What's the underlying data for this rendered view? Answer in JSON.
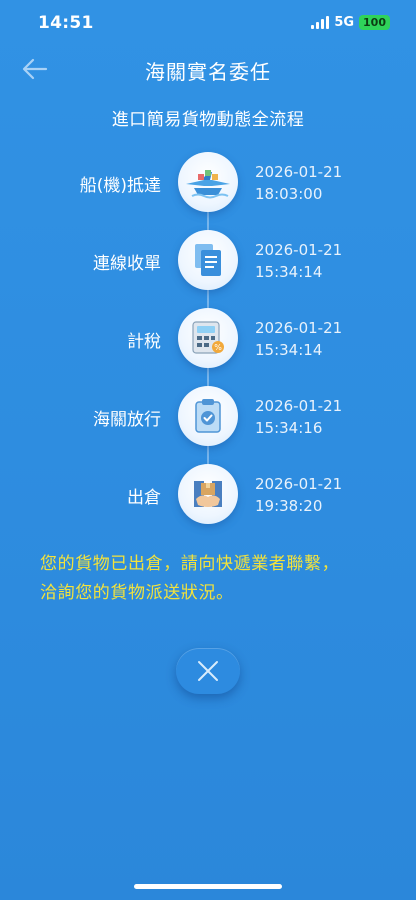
{
  "status_bar": {
    "time": "14:51",
    "network": "5G",
    "battery": "100"
  },
  "header": {
    "title": "海關實名委任",
    "back_icon": "arrow-left-icon"
  },
  "subtitle": "進口簡易貨物動態全流程",
  "steps": [
    {
      "label": "船(機)抵達",
      "date": "2026-01-21",
      "time": "18:03:00",
      "icon": "ship-plane-icon"
    },
    {
      "label": "連線收單",
      "date": "2026-01-21",
      "time": "15:34:14",
      "icon": "documents-icon"
    },
    {
      "label": "計稅",
      "date": "2026-01-21",
      "time": "15:34:14",
      "icon": "calculator-icon"
    },
    {
      "label": "海關放行",
      "date": "2026-01-21",
      "time": "15:34:16",
      "icon": "clipboard-check-icon"
    },
    {
      "label": "出倉",
      "date": "2026-01-21",
      "time": "19:38:20",
      "icon": "package-handover-icon"
    }
  ],
  "message": {
    "line1": "您的貨物已出倉，請向快遞業者聯繫，",
    "line2": "洽詢您的貨物派送狀況。"
  },
  "close_button": {
    "icon": "close-icon"
  },
  "colors": {
    "background": "#2e8de0",
    "message_text": "#f2e23c",
    "battery": "#2fd35a"
  }
}
